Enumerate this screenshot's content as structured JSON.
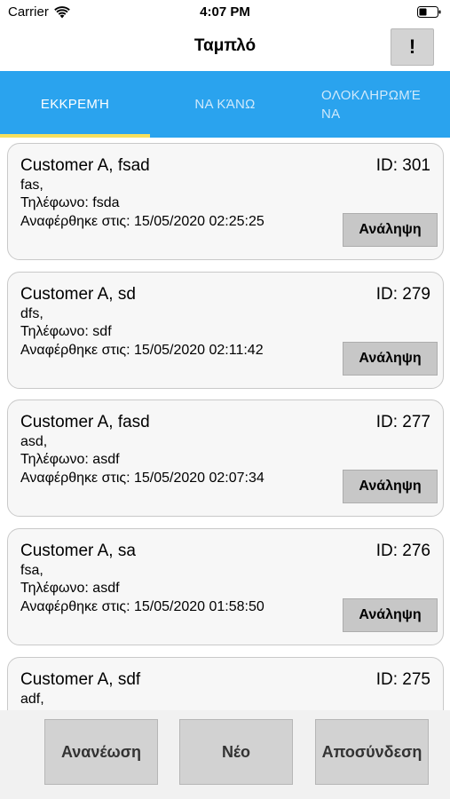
{
  "status_bar": {
    "carrier": "Carrier",
    "time": "4:07 PM",
    "wifi_icon": "wifi-icon",
    "battery_icon": "battery-icon"
  },
  "nav": {
    "title": "Ταμπλό",
    "alert_label": "!"
  },
  "tabs": [
    {
      "label": "ΕΚΚΡΕΜΉ",
      "selected": true
    },
    {
      "label": "ΝΑ ΚΆΝΩ",
      "selected": false
    },
    {
      "label": "ΟΛΟΚΛΗΡΩΜΈ\nΝΑ",
      "selected": false
    }
  ],
  "colors": {
    "tab_bar": "#2aa3ee",
    "tab_indicator": "#f6e05e",
    "card_bg": "#f7f7f7",
    "button_bg": "#c7c7c7"
  },
  "items": [
    {
      "name": "Customer A, fsad",
      "id": "ID: 301",
      "detail": "fas,",
      "phone": "Τηλέφωνο: fsda",
      "reported": "Αναφέρθηκε στις: 15/05/2020 02:25:25",
      "action": "Ανάληψη"
    },
    {
      "name": "Customer A, sd",
      "id": "ID: 279",
      "detail": "dfs,",
      "phone": "Τηλέφωνο: sdf",
      "reported": "Αναφέρθηκε στις: 15/05/2020 02:11:42",
      "action": "Ανάληψη"
    },
    {
      "name": "Customer A, fasd",
      "id": "ID: 277",
      "detail": "asd,",
      "phone": "Τηλέφωνο: asdf",
      "reported": "Αναφέρθηκε στις: 15/05/2020 02:07:34",
      "action": "Ανάληψη"
    },
    {
      "name": "Customer A, sa",
      "id": "ID: 276",
      "detail": "fsa,",
      "phone": "Τηλέφωνο: asdf",
      "reported": "Αναφέρθηκε στις: 15/05/2020 01:58:50",
      "action": "Ανάληψη"
    },
    {
      "name": "Customer A, sdf",
      "id": "ID: 275",
      "detail": "adf,",
      "phone": "",
      "reported": "",
      "action": ""
    }
  ],
  "bottom": {
    "refresh_label": "Ανανέωση",
    "new_label": "Νέο",
    "logout_label": "Αποσύνδεση"
  }
}
